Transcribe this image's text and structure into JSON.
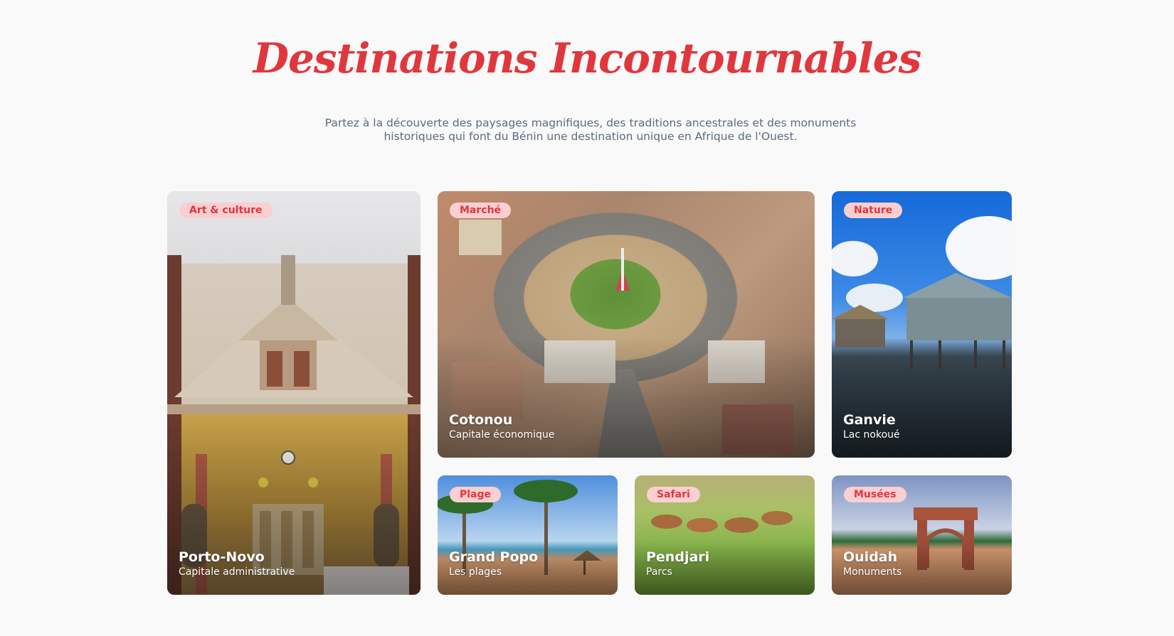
{
  "header": {
    "title": "Destinations Incontournables",
    "subtitle_line1": "Partez à la découverte des paysages magnifiques, des traditions ancestrales et des monuments",
    "subtitle_line2": "historiques qui font du Bénin une destination unique en Afrique de l'Ouest."
  },
  "colors": {
    "accent": "#e0373d",
    "badge_bg": "#f9cfd1",
    "page_bg": "#f9f9f9"
  },
  "destinations": [
    {
      "badge": "Art & culture",
      "name": "Porto-Novo",
      "caption": "Capitale administrative"
    },
    {
      "badge": "Marché",
      "name": "Cotonou",
      "caption": "Capitale économique"
    },
    {
      "badge": "Nature",
      "name": "Ganvie",
      "caption": "Lac nokoué"
    },
    {
      "badge": "Plage",
      "name": "Grand Popo",
      "caption": "Les plages"
    },
    {
      "badge": "Safari",
      "name": "Pendjari",
      "caption": "Parcs"
    },
    {
      "badge": "Musées",
      "name": "Ouidah",
      "caption": "Monuments"
    }
  ]
}
